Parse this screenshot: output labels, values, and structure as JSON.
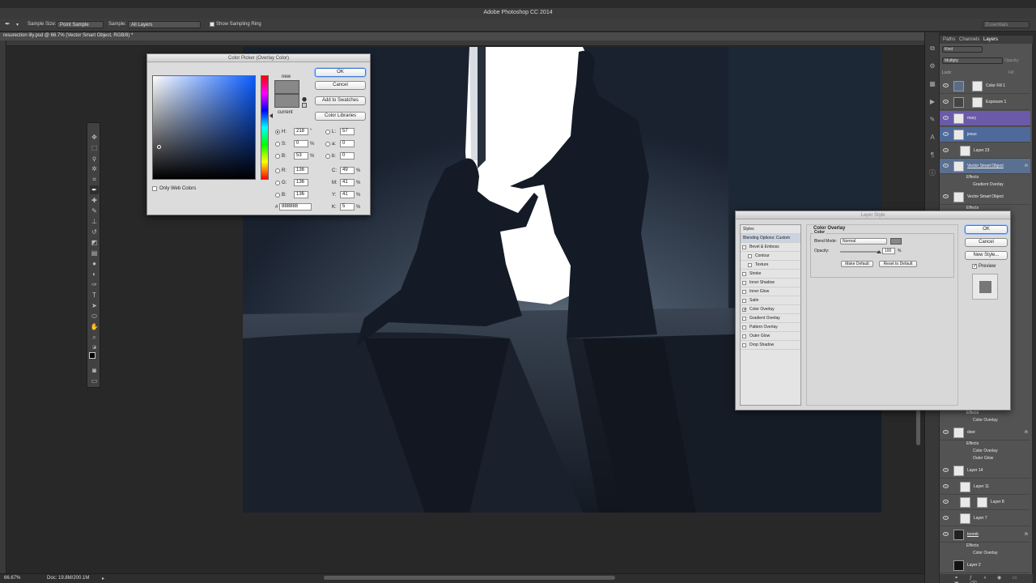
{
  "app": {
    "title": "Adobe Photoshop CC 2014"
  },
  "options_bar": {
    "sample_size_label": "Sample Size:",
    "sample_size_value": "Point Sample",
    "sample_label": "Sample:",
    "sample_value": "All Layers",
    "show_ring_label": "Show Sampling Ring",
    "workspace": "Essentials"
  },
  "document": {
    "tab_title": "resurection lily.psd @ 66.7% (Vector Smart Object, RGB/8) *",
    "zoom": "66.67%",
    "doc_size": "Doc: 19.8M/200.1M"
  },
  "color_picker": {
    "title": "Color Picker (Overlay Color)",
    "new_label": "new",
    "current_label": "current",
    "ok": "OK",
    "cancel": "Cancel",
    "add_swatches": "Add to Swatches",
    "color_libraries": "Color Libraries",
    "only_web_colors": "Only Web Colors",
    "selected_color": "#888888",
    "fields": {
      "H": "218",
      "S": "0",
      "B": "53",
      "R": "136",
      "G": "136",
      "Bv": "136",
      "L": "57",
      "a": "0",
      "b": "0",
      "C": "49",
      "M": "41",
      "Y": "41",
      "K": "5",
      "hex": "888888"
    }
  },
  "layer_style": {
    "title": "Layer Style",
    "styles_header": "Styles",
    "blending_options": "Blending Options: Custom",
    "items": [
      {
        "label": "Bevel & Emboss",
        "checked": false
      },
      {
        "label": "Contour",
        "checked": false
      },
      {
        "label": "Texture",
        "checked": false
      },
      {
        "label": "Stroke",
        "checked": false
      },
      {
        "label": "Inner Shadow",
        "checked": false
      },
      {
        "label": "Inner Glow",
        "checked": false
      },
      {
        "label": "Satin",
        "checked": false
      },
      {
        "label": "Color Overlay",
        "checked": true
      },
      {
        "label": "Gradient Overlay",
        "checked": false
      },
      {
        "label": "Pattern Overlay",
        "checked": false
      },
      {
        "label": "Outer Glow",
        "checked": false
      },
      {
        "label": "Drop Shadow",
        "checked": false
      }
    ],
    "section_title": "Color Overlay",
    "group_title": "Color",
    "blend_mode_label": "Blend Mode:",
    "blend_mode_value": "Normal",
    "opacity_label": "Opacity:",
    "opacity_value": "100",
    "opacity_unit": "%",
    "make_default": "Make Default",
    "reset_default": "Reset to Default",
    "ok": "OK",
    "cancel": "Cancel",
    "new_style": "New Style...",
    "preview": "Preview"
  },
  "layers_panel": {
    "tabs": [
      "Paths",
      "Channels",
      "Layers"
    ],
    "kind": "Kind",
    "blend": "Multiply",
    "opacity_label": "Opacity:",
    "lock_label": "Lock:",
    "fill_label": "Fill:",
    "layers": [
      {
        "name": "Color Fill 1"
      },
      {
        "name": "Exposure 1"
      },
      {
        "name": "mary"
      },
      {
        "name": "jesus"
      },
      {
        "name": "Layer 23"
      },
      {
        "name": "Vector Smart Object",
        "effects": "Effects",
        "sub": "Gradient Overlay"
      },
      {
        "name": "Vector Smart Object",
        "effects": "Effects"
      }
    ],
    "lower_layers": [
      {
        "name": "door",
        "effects": "Effects",
        "sub": [
          "Color Overlay",
          "Outer Glow"
        ]
      },
      {
        "name": "Layer 14"
      },
      {
        "name": "Layer 11"
      },
      {
        "name": "Layer 8"
      },
      {
        "name": "Layer 7"
      },
      {
        "name": "toomb",
        "effects": "Effects",
        "sub": [
          "Color Overlay"
        ]
      },
      {
        "name": "Layer 2"
      }
    ],
    "top_effect": {
      "effects": "Effects",
      "sub": "Color Overlay"
    }
  }
}
